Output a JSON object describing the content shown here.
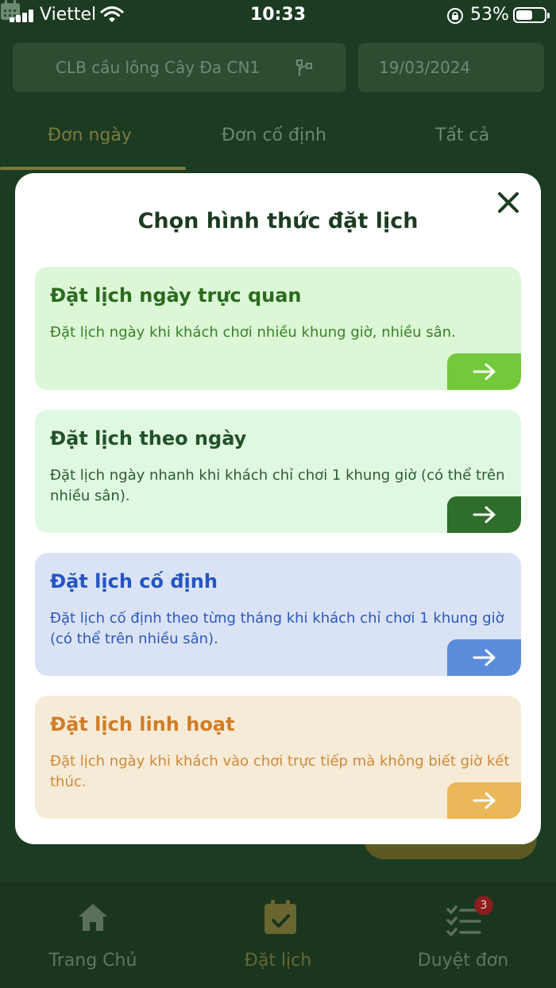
{
  "status_bar": {
    "carrier": "Viettel",
    "time": "10:33",
    "battery": "53%"
  },
  "header": {
    "club_select": "CLB cầu lông Cây Đa CN1",
    "date_select": "19/03/2024"
  },
  "tabs": [
    {
      "label": "Đơn ngày"
    },
    {
      "label": "Đơn cố định"
    },
    {
      "label": "Tất cả"
    }
  ],
  "modal": {
    "title": "Chọn hình thức đặt lịch",
    "options": [
      {
        "title": "Đặt lịch ngày trực quan",
        "description": "Đặt lịch ngày khi khách chơi nhiều khung giờ, nhiều sân."
      },
      {
        "title": "Đặt lịch theo ngày",
        "description": "Đặt lịch ngày nhanh khi khách chỉ chơi 1 khung giờ (có thể trên nhiều sân)."
      },
      {
        "title": "Đặt lịch cố định",
        "description": "Đặt lịch cố định theo từng tháng khi khách chỉ chơi 1 khung giờ (có thể trên nhiều sân)."
      },
      {
        "title": "Đặt lịch linh hoạt",
        "description": "Đặt lịch ngày khi khách vào chơi trực tiếp mà không biết giờ kết thúc."
      }
    ]
  },
  "bottom_nav": [
    {
      "label": "Trang Chủ",
      "icon": "home-icon"
    },
    {
      "label": "Đặt lịch",
      "icon": "calendar-check-icon"
    },
    {
      "label": "Duyệt đơn",
      "icon": "checklist-icon",
      "badge": "3"
    }
  ],
  "colors": {
    "background": "#1b3b22",
    "modal_bg": "#ffffff",
    "option1_accent": "#73c93b",
    "option2_accent": "#2f6d2a",
    "option3_accent": "#5b8cdc",
    "option4_accent": "#eab85a"
  }
}
